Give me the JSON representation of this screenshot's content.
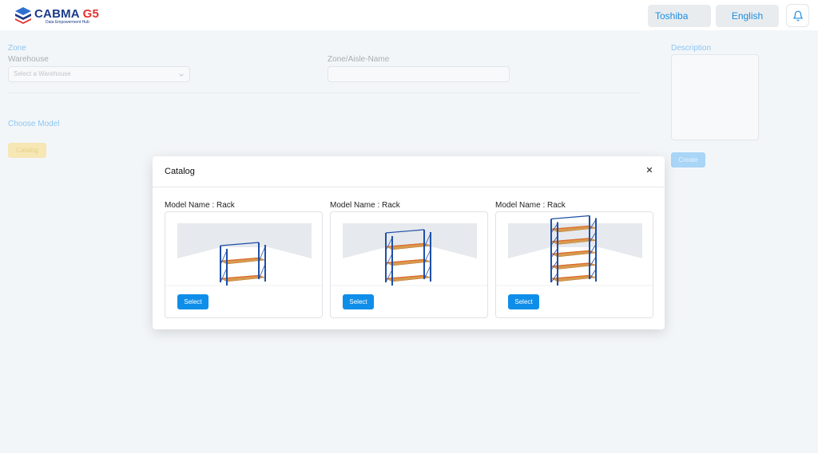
{
  "header": {
    "logo_text": "CABMA",
    "logo_accent": "G5",
    "logo_subtitle": "Data Empowerment Hub",
    "org_button": "Toshiba",
    "language_button": "English",
    "notification_icon": "bell-icon"
  },
  "form": {
    "zone_label": "Zone",
    "warehouse_label": "Warehouse",
    "warehouse_placeholder": "Select a Warehouse",
    "zone_name_label": "Zone/Aisle-Name",
    "choose_model_label": "Choose Model",
    "catalog_button": "Catalog",
    "description_label": "Description",
    "create_button": "Create"
  },
  "modal": {
    "title": "Catalog",
    "close_icon": "close-icon",
    "cards": [
      {
        "title": "Model Name : Rack",
        "select_label": "Select",
        "levels": 2
      },
      {
        "title": "Model Name : Rack",
        "select_label": "Select",
        "levels": 3
      },
      {
        "title": "Model Name : Rack",
        "select_label": "Select",
        "levels": 5
      }
    ]
  },
  "colors": {
    "brand_blue": "#1b3a8a",
    "brand_red": "#e2322f",
    "primary": "#0f8ee9",
    "rack_frame": "#1f4fa8",
    "rack_shelf": "#d89a4e"
  }
}
